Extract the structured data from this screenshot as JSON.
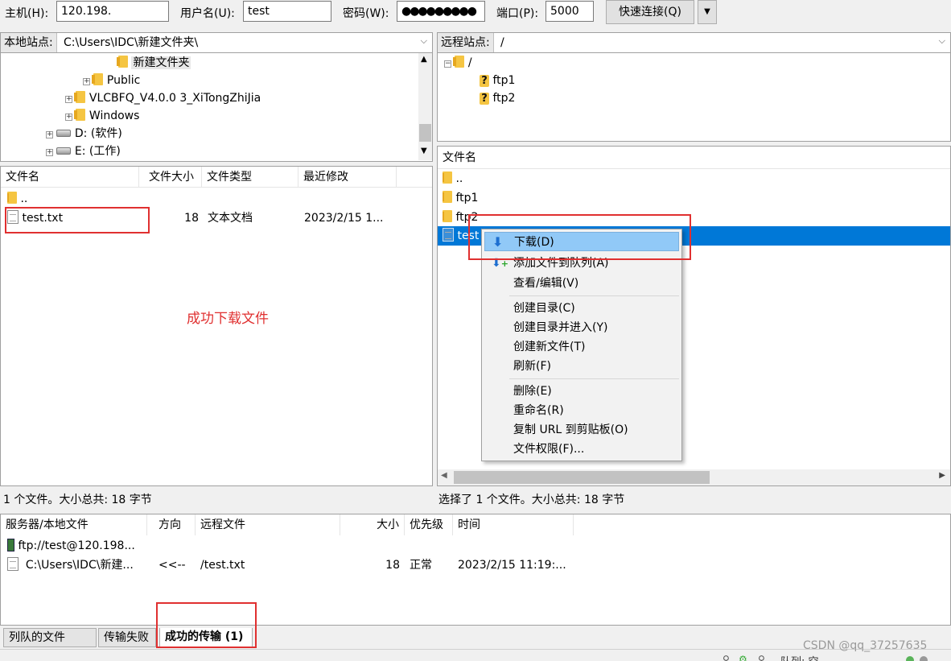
{
  "quickconnect": {
    "host_label": "主机(H):",
    "host_value": "120.198.",
    "user_label": "用户名(U):",
    "user_value": "test",
    "pass_label": "密码(W):",
    "pass_value": "●●●●●●●●●",
    "port_label": "端口(P):",
    "port_value": "5000",
    "connect_button": "快速连接(Q)",
    "dropdown_glyph": "▼"
  },
  "local": {
    "site_label": "本地站点:",
    "site_path": "C:\\Users\\IDC\\新建文件夹\\",
    "tree": [
      {
        "label": "新建文件夹"
      },
      {
        "label": "Public"
      },
      {
        "label": "VLCBFQ_V4.0.0 3_XiTongZhiJia"
      },
      {
        "label": "Windows"
      },
      {
        "label": "D: (软件)"
      },
      {
        "label": "E: (工作)"
      }
    ],
    "columns": [
      "文件名",
      "文件大小",
      "文件类型",
      "最近修改"
    ],
    "files": [
      {
        "name": "..",
        "size": "",
        "type": "",
        "modified": ""
      },
      {
        "name": "test.txt",
        "size": "18",
        "type": "文本文档",
        "modified": "2023/2/15 1..."
      }
    ],
    "annotation": "成功下载文件",
    "status": "1 个文件。大小总共: 18 字节"
  },
  "remote": {
    "site_label": "远程站点:",
    "site_path": "/",
    "tree": [
      {
        "label": "/"
      },
      {
        "label": "ftp1"
      },
      {
        "label": "ftp2"
      }
    ],
    "column": "文件名",
    "files": [
      {
        "name": ".."
      },
      {
        "name": "ftp1"
      },
      {
        "name": "ftp2"
      },
      {
        "name": "test"
      }
    ],
    "status": "选择了 1 个文件。大小总共: 18 字节"
  },
  "context_menu": {
    "items": [
      {
        "label": "下载(D)"
      },
      {
        "label": "添加文件到队列(A)"
      },
      {
        "label": "查看/编辑(V)"
      },
      {
        "label": "创建目录(C)"
      },
      {
        "label": "创建目录并进入(Y)"
      },
      {
        "label": "创建新文件(T)"
      },
      {
        "label": "刷新(F)"
      },
      {
        "label": "删除(E)"
      },
      {
        "label": "重命名(R)"
      },
      {
        "label": "复制 URL 到剪贴板(O)"
      },
      {
        "label": "文件权限(F)..."
      }
    ]
  },
  "queue": {
    "columns": [
      "服务器/本地文件",
      "方向",
      "远程文件",
      "大小",
      "优先级",
      "时间"
    ],
    "server": "ftp://test@120.198...",
    "entry": {
      "local": "C:\\Users\\IDC\\新建...",
      "direction": "<<--",
      "remote": "/test.txt",
      "size": "18",
      "priority": "正常",
      "time": "2023/2/15 11:19:..."
    }
  },
  "tabs": [
    "列队的文件",
    "传输失败",
    "成功的传输 (1)"
  ],
  "watermark": "CSDN @qq_37257635",
  "statusbar_text": "队列: 空",
  "colors": {
    "accent": "#0078d7",
    "highlight": "#91c9f7",
    "annotation_red": "#e03030"
  }
}
